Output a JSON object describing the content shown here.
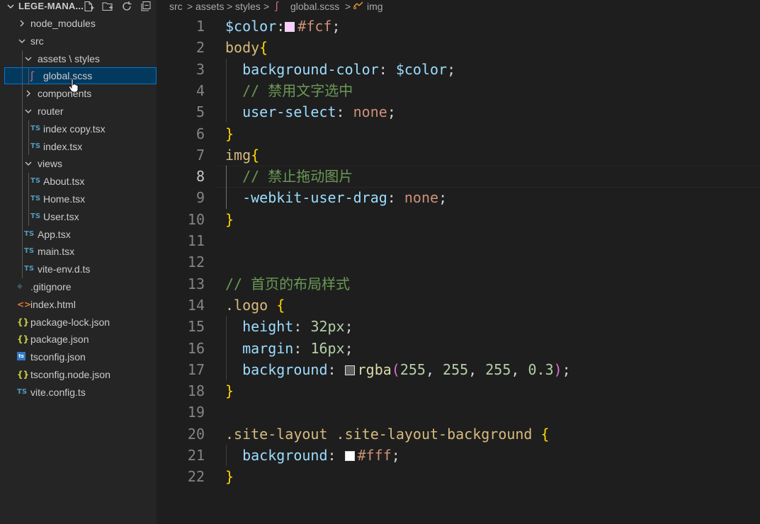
{
  "explorer": {
    "title": "LEGE-MANA...",
    "actions": [
      "new-file-icon",
      "new-folder-icon",
      "refresh-icon",
      "collapse-all-icon"
    ]
  },
  "tree": [
    {
      "label": "node_modules",
      "kind": "folder",
      "expanded": false
    },
    {
      "label": "src",
      "kind": "folder",
      "expanded": true
    },
    {
      "label": "assets \\ styles",
      "kind": "folder",
      "expanded": true
    },
    {
      "label": "global.scss",
      "kind": "scss",
      "selected": true
    },
    {
      "label": "components",
      "kind": "folder",
      "expanded": false
    },
    {
      "label": "router",
      "kind": "folder",
      "expanded": true
    },
    {
      "label": "index copy.tsx",
      "kind": "ts",
      "badge": "TS"
    },
    {
      "label": "index.tsx",
      "kind": "ts",
      "badge": "TS"
    },
    {
      "label": "views",
      "kind": "folder",
      "expanded": true
    },
    {
      "label": "About.tsx",
      "kind": "ts",
      "badge": "TS"
    },
    {
      "label": "Home.tsx",
      "kind": "ts",
      "badge": "TS"
    },
    {
      "label": "User.tsx",
      "kind": "ts",
      "badge": "TS"
    },
    {
      "label": "App.tsx",
      "kind": "ts",
      "badge": "TS"
    },
    {
      "label": "main.tsx",
      "kind": "ts",
      "badge": "TS"
    },
    {
      "label": "vite-env.d.ts",
      "kind": "ts",
      "badge": "TS"
    },
    {
      "label": ".gitignore",
      "kind": "git"
    },
    {
      "label": "index.html",
      "kind": "html",
      "badge": "<>"
    },
    {
      "label": "package-lock.json",
      "kind": "json",
      "badge": "{}"
    },
    {
      "label": "package.json",
      "kind": "json",
      "badge": "{}"
    },
    {
      "label": "tsconfig.json",
      "kind": "tsconfig",
      "badge": "ts"
    },
    {
      "label": "tsconfig.node.json",
      "kind": "json",
      "badge": "{}"
    },
    {
      "label": "vite.config.ts",
      "kind": "ts",
      "badge": "TS"
    }
  ],
  "breadcrumb": {
    "items": [
      "src",
      "assets",
      "styles",
      "global.scss",
      "img"
    ],
    "separator": ">"
  },
  "editor": {
    "active_line": "8",
    "lines": [
      {
        "n": "1",
        "tokens": [
          {
            "t": "$color",
            "c": "c-var"
          },
          {
            "t": ":",
            "c": "c-punc"
          },
          {
            "swatch": "#ffccff"
          },
          {
            "t": "#fcf",
            "c": "c-val"
          },
          {
            "t": ";",
            "c": "c-punc"
          }
        ]
      },
      {
        "n": "2",
        "tokens": [
          {
            "t": "body",
            "c": "c-sel"
          },
          {
            "t": "{",
            "c": "c-b1"
          }
        ]
      },
      {
        "n": "3",
        "indent": 1,
        "tokens": [
          {
            "t": "background-color",
            "c": "c-prop"
          },
          {
            "t": ": ",
            "c": "c-punc"
          },
          {
            "t": "$color",
            "c": "c-var"
          },
          {
            "t": ";",
            "c": "c-punc"
          }
        ]
      },
      {
        "n": "4",
        "indent": 1,
        "tokens": [
          {
            "t": "// 禁用文字选中",
            "c": "c-com"
          }
        ]
      },
      {
        "n": "5",
        "indent": 1,
        "tokens": [
          {
            "t": "user-select",
            "c": "c-prop"
          },
          {
            "t": ": ",
            "c": "c-punc"
          },
          {
            "t": "none",
            "c": "c-val"
          },
          {
            "t": ";",
            "c": "c-punc"
          }
        ]
      },
      {
        "n": "6",
        "tokens": [
          {
            "t": "}",
            "c": "c-b1"
          }
        ]
      },
      {
        "n": "7",
        "tokens": [
          {
            "t": "img",
            "c": "c-sel"
          },
          {
            "t": "{",
            "c": "c-b1"
          }
        ]
      },
      {
        "n": "8",
        "indent": 1,
        "tokens": [
          {
            "t": "// 禁止拖动图片",
            "c": "c-com"
          }
        ]
      },
      {
        "n": "9",
        "indent": 1,
        "tokens": [
          {
            "t": "-webkit-user-drag",
            "c": "c-prop"
          },
          {
            "t": ": ",
            "c": "c-punc"
          },
          {
            "t": "none",
            "c": "c-val"
          },
          {
            "t": ";",
            "c": "c-punc"
          }
        ]
      },
      {
        "n": "10",
        "tokens": [
          {
            "t": "}",
            "c": "c-b1"
          }
        ]
      },
      {
        "n": "11",
        "tokens": []
      },
      {
        "n": "12",
        "tokens": []
      },
      {
        "n": "13",
        "tokens": [
          {
            "t": "// 首页的布局样式",
            "c": "c-com"
          }
        ]
      },
      {
        "n": "14",
        "tokens": [
          {
            "t": ".logo ",
            "c": "c-sel"
          },
          {
            "t": "{",
            "c": "c-b1"
          }
        ]
      },
      {
        "n": "15",
        "indent": 1,
        "tokens": [
          {
            "t": "height",
            "c": "c-prop"
          },
          {
            "t": ": ",
            "c": "c-punc"
          },
          {
            "t": "32px",
            "c": "c-num"
          },
          {
            "t": ";",
            "c": "c-punc"
          }
        ]
      },
      {
        "n": "16",
        "indent": 1,
        "tokens": [
          {
            "t": "margin",
            "c": "c-prop"
          },
          {
            "t": ": ",
            "c": "c-punc"
          },
          {
            "t": "16px",
            "c": "c-num"
          },
          {
            "t": ";",
            "c": "c-punc"
          }
        ]
      },
      {
        "n": "17",
        "indent": 1,
        "tokens": [
          {
            "t": "background",
            "c": "c-prop"
          },
          {
            "t": ": ",
            "c": "c-punc"
          },
          {
            "swatch": "rgba(255,255,255,0.3)"
          },
          {
            "t": "rgba",
            "c": "c-fn"
          },
          {
            "t": "(",
            "c": "c-b2"
          },
          {
            "t": "255",
            "c": "c-num"
          },
          {
            "t": ", ",
            "c": "c-punc"
          },
          {
            "t": "255",
            "c": "c-num"
          },
          {
            "t": ", ",
            "c": "c-punc"
          },
          {
            "t": "255",
            "c": "c-num"
          },
          {
            "t": ", ",
            "c": "c-punc"
          },
          {
            "t": "0.3",
            "c": "c-num"
          },
          {
            "t": ")",
            "c": "c-b2"
          },
          {
            "t": ";",
            "c": "c-punc"
          }
        ]
      },
      {
        "n": "18",
        "tokens": [
          {
            "t": "}",
            "c": "c-b1"
          }
        ]
      },
      {
        "n": "19",
        "tokens": []
      },
      {
        "n": "20",
        "tokens": [
          {
            "t": ".site-layout .site-layout-background ",
            "c": "c-sel"
          },
          {
            "t": "{",
            "c": "c-b1"
          }
        ]
      },
      {
        "n": "21",
        "indent": 1,
        "tokens": [
          {
            "t": "background",
            "c": "c-prop"
          },
          {
            "t": ": ",
            "c": "c-punc"
          },
          {
            "swatch": "#ffffff"
          },
          {
            "t": "#fff",
            "c": "c-val"
          },
          {
            "t": ";",
            "c": "c-punc"
          }
        ]
      },
      {
        "n": "22",
        "tokens": [
          {
            "t": "}",
            "c": "c-b1"
          }
        ]
      }
    ]
  }
}
